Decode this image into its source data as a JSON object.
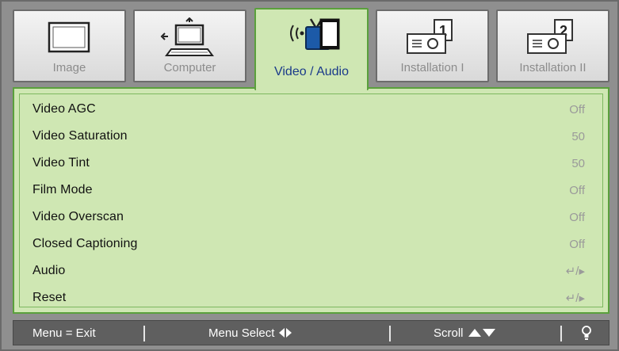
{
  "tabs": [
    {
      "label": "Image",
      "icon": "image-icon",
      "active": false
    },
    {
      "label": "Computer",
      "icon": "computer-icon",
      "active": false
    },
    {
      "label": "Video / Audio",
      "icon": "video-audio-icon",
      "active": true
    },
    {
      "label": "Installation I",
      "icon": "projector-1-icon",
      "active": false
    },
    {
      "label": "Installation II",
      "icon": "projector-2-icon",
      "active": false
    }
  ],
  "menu_items": [
    {
      "name": "Video AGC",
      "value": "Off"
    },
    {
      "name": "Video Saturation",
      "value": "50"
    },
    {
      "name": "Video Tint",
      "value": "50"
    },
    {
      "name": "Film Mode",
      "value": "Off"
    },
    {
      "name": "Video Overscan",
      "value": "Off"
    },
    {
      "name": "Closed Captioning",
      "value": "Off"
    },
    {
      "name": "Audio",
      "value": "↵/▸"
    },
    {
      "name": "Reset",
      "value": "↵/▸"
    }
  ],
  "footer": {
    "menu_exit": "Menu = Exit",
    "menu_select": "Menu Select",
    "scroll": "Scroll",
    "bulb_icon": "lightbulb-icon"
  },
  "colors": {
    "panel_bg": "#cfe7b3",
    "panel_border": "#5aa03c",
    "active_tab_text": "#1a3a8a",
    "frame_gray": "#8f8f8f",
    "footer_bg": "#5f5f5f"
  }
}
